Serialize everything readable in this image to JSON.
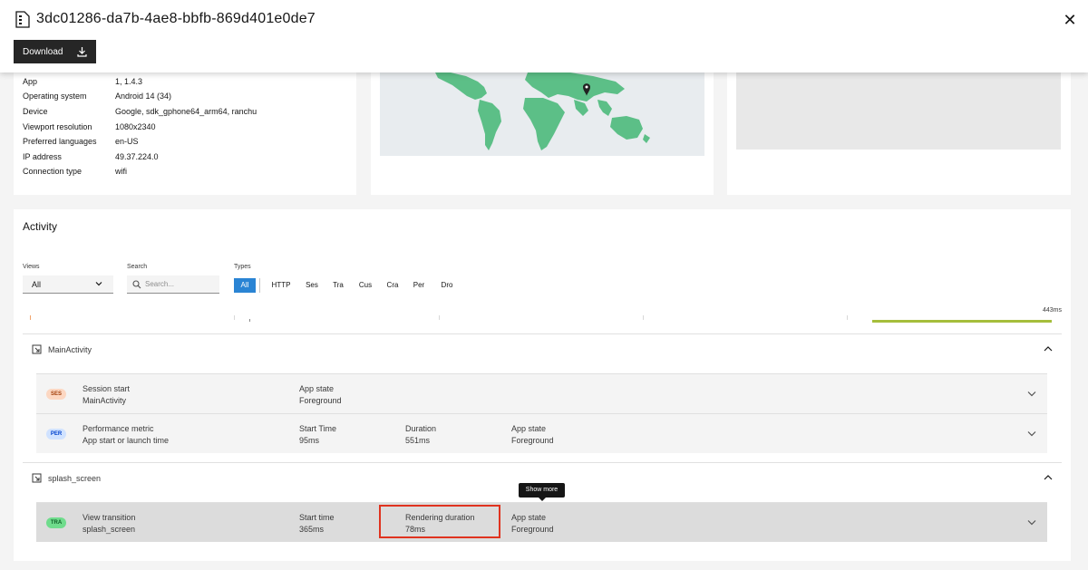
{
  "header": {
    "title": "3dc01286-da7b-4ae8-bbfb-869d401e0de7",
    "download_label": "Download"
  },
  "device_info": {
    "rows": [
      {
        "key": "App",
        "value": "1, 1.4.3"
      },
      {
        "key": "Operating system",
        "value": "Android 14 (34)"
      },
      {
        "key": "Device",
        "value": "Google, sdk_gphone64_arm64, ranchu"
      },
      {
        "key": "Viewport resolution",
        "value": "1080x2340"
      },
      {
        "key": "Preferred languages",
        "value": "en-US"
      },
      {
        "key": "IP address",
        "value": "49.37.224.0"
      },
      {
        "key": "Connection type",
        "value": "wifi"
      }
    ]
  },
  "map": {
    "land_color": "#5cbf87",
    "water_color": "#e8ecef"
  },
  "activity": {
    "title": "Activity",
    "views_label": "Views",
    "views_value": "All",
    "search_label": "Search",
    "search_placeholder": "Search...",
    "types_label": "Types",
    "types": [
      "All",
      "HTTP",
      "Ses",
      "Tra",
      "Cus",
      "Cra",
      "Per",
      "Dro"
    ],
    "timeline_end": "443ms",
    "accent": "#2a84d4",
    "sections": [
      {
        "name": "MainActivity"
      },
      {
        "name": "splash_screen"
      }
    ],
    "events": [
      {
        "tag": "SES",
        "title": "Session start",
        "subtitle": "MainActivity",
        "c1_label": "App state",
        "c1_value": "Foreground"
      },
      {
        "tag": "PER",
        "title": "Performance metric",
        "subtitle": "App start or launch time",
        "c1_label": "Start Time",
        "c1_value": "95ms",
        "c2_label": "Duration",
        "c2_value": "551ms",
        "c3_label": "App state",
        "c3_value": "Foreground"
      },
      {
        "tag": "TRA",
        "title": "View transition",
        "subtitle": "splash_screen",
        "c1_label": "Start time",
        "c1_value": "365ms",
        "c2_label": "Rendering duration",
        "c2_value": "78ms",
        "c3_label": "App state",
        "c3_value": "Foreground"
      }
    ],
    "tooltip": "Show more"
  }
}
